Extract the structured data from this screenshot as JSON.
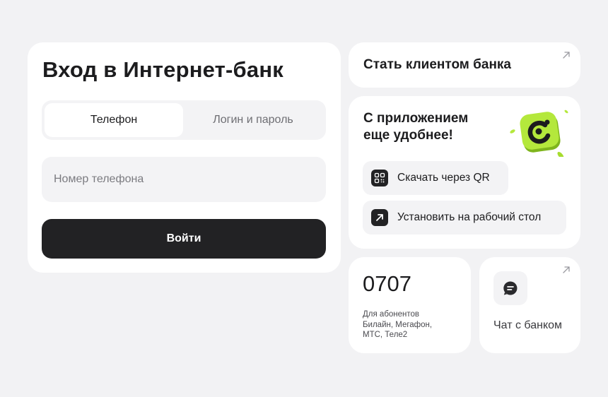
{
  "login": {
    "title": "Вход в Интернет-банк",
    "tabs": [
      {
        "label": "Телефон",
        "active": true
      },
      {
        "label": "Логин и пароль",
        "active": false
      }
    ],
    "phone_placeholder": "Номер телефона",
    "submit_label": "Войти"
  },
  "become_client": {
    "label": "Стать клиентом банка",
    "icon": "arrow-up-right-icon"
  },
  "app_promo": {
    "heading_line1": "С приложением",
    "heading_line2": "еще удобнее!",
    "logo_icon": "bank-app-logo-icon",
    "accent_color": "#b4e83c",
    "actions": [
      {
        "label": "Скачать через QR",
        "icon": "qr-code-icon"
      },
      {
        "label": "Установить на рабочий стол",
        "icon": "arrow-up-right-icon"
      }
    ]
  },
  "short_number": {
    "number": "0707",
    "desc_line1": "Для абонентов",
    "desc_line2": "Билайн, Мегафон,",
    "desc_line3": "МТС, Теле2"
  },
  "chat": {
    "label": "Чат с банком",
    "icon": "chat-bubble-icon",
    "corner_icon": "arrow-up-right-icon"
  }
}
